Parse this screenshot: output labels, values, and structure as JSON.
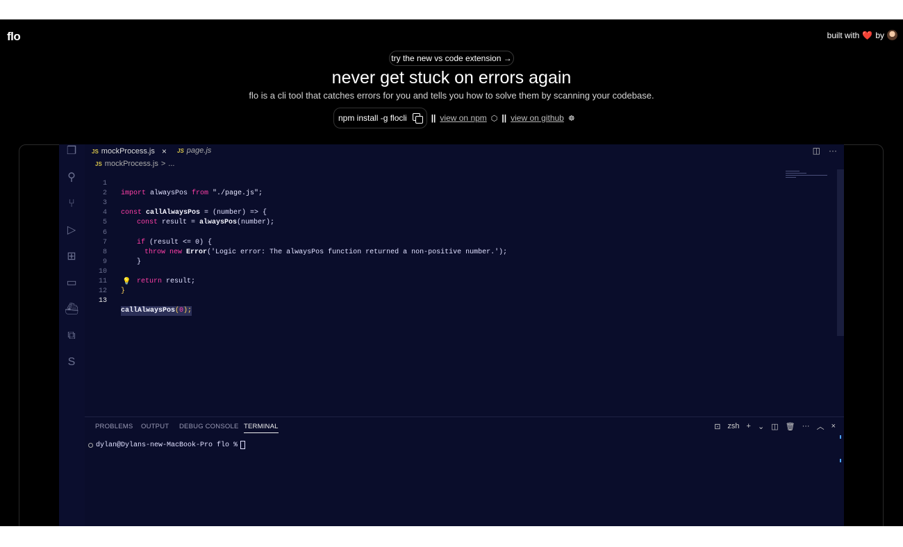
{
  "header": {
    "logo": "flo",
    "built_with": "built with",
    "heart": "❤️",
    "by": "by"
  },
  "hero": {
    "pill": "try the new vs code extension →",
    "title": "never get stuck on errors again",
    "subtitle": "flo is a cli tool that catches errors for you and tells you how to solve them by scanning your codebase.",
    "install_cmd": "npm install -g flocli",
    "separator": "||",
    "npm_link": "view on npm",
    "github_link": "view on github"
  },
  "editor": {
    "tabs": [
      {
        "badge": "JS",
        "label": "mockProcess.js",
        "close": "×"
      },
      {
        "badge": "JS",
        "label": "page.js"
      }
    ],
    "breadcrumb": {
      "badge": "JS",
      "file": "mockProcess.js",
      "sep": ">",
      "rest": "..."
    },
    "line_numbers": [
      "1",
      "2",
      "3",
      "4",
      "5",
      "6",
      "7",
      "8",
      "9",
      "10",
      "11",
      "12",
      "13"
    ],
    "code": {
      "l1_kw1": "import",
      "l1_mid": " alwaysPos ",
      "l1_kw2": "from",
      "l1_str": " \"./page.js\";",
      "l3_kw": "const",
      "l3_fn": " callAlwaysPos",
      "l3_rest": " = (number) => {",
      "l4_kw": "const",
      "l4_mid": " result = ",
      "l4_fn": "alwaysPos",
      "l4_rest": "(number);",
      "l6_kw": "if",
      "l6_rest": " (result <= 0) {",
      "l7_kw1": "throw",
      "l7_kw2": " new",
      "l7_fn": " Error",
      "l7_rest": "('Logic error: The alwaysPos function returned a non-positive number.');",
      "l8": "}",
      "l10_kw": "return",
      "l10_rest": " result;",
      "l11": "}",
      "l13_fn": "callAlwaysPos",
      "l13_open": "(",
      "l13_arg": "0",
      "l13_close": ");"
    }
  },
  "panel": {
    "tabs": [
      "PROBLEMS",
      "OUTPUT",
      "DEBUG CONSOLE",
      "TERMINAL"
    ],
    "active_tab": "TERMINAL",
    "shell": "zsh",
    "prompt": "dylan@Dylans-new-MacBook-Pro flo % "
  },
  "colors": {
    "editor_bg": "#0a0d2b",
    "keyword": "#ff3fa7",
    "bracket": "#ffd35a",
    "page_bg": "#000000"
  }
}
